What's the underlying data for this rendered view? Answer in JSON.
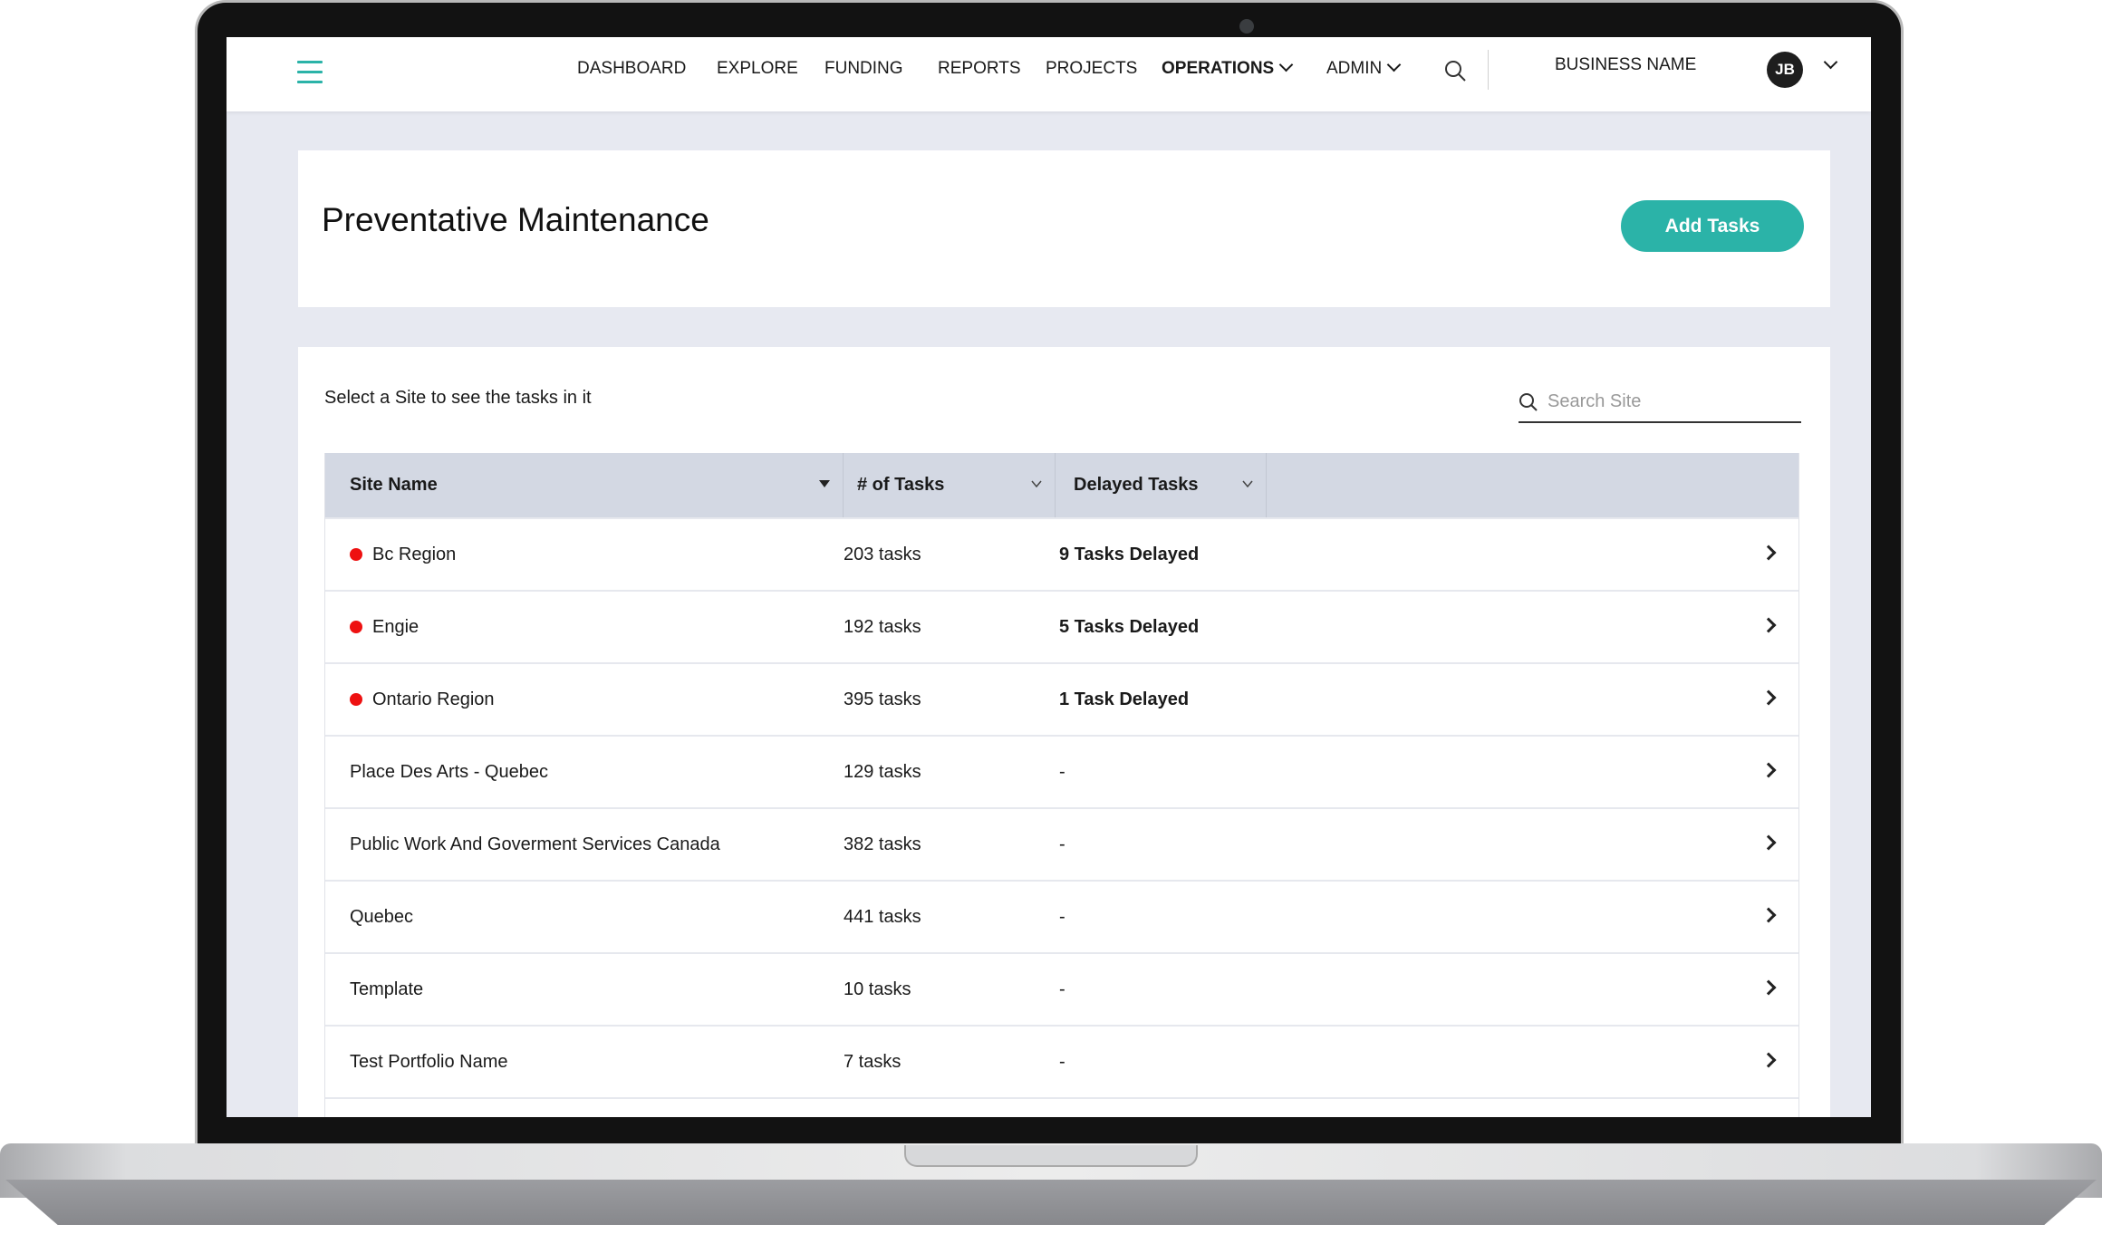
{
  "nav": {
    "items": [
      {
        "label": "DASHBOARD"
      },
      {
        "label": "EXPLORE"
      },
      {
        "label": "FUNDING"
      },
      {
        "label": "REPORTS"
      },
      {
        "label": "PROJECTS"
      },
      {
        "label": "OPERATIONS",
        "active": true,
        "dropdown": true
      },
      {
        "label": "ADMIN",
        "dropdown": true
      }
    ],
    "business_name": "BUSINESS NAME",
    "avatar_initials": "JB",
    "icons": {
      "menu": "hamburger-icon",
      "search": "search-icon",
      "user_menu": "chevron-down-icon"
    }
  },
  "header": {
    "title": "Preventative Maintenance",
    "add_button": "Add Tasks"
  },
  "sites": {
    "hint": "Select a Site to see the tasks in it",
    "search_placeholder": "Search Site",
    "search_value": "",
    "columns": [
      "Site Name",
      "# of Tasks",
      "Delayed Tasks"
    ],
    "rows": [
      {
        "name": "Bc Region",
        "tasks": "203 tasks",
        "delayed": "9 Tasks Delayed",
        "alert": true
      },
      {
        "name": "Engie",
        "tasks": "192 tasks",
        "delayed": "5 Tasks Delayed",
        "alert": true
      },
      {
        "name": "Ontario Region",
        "tasks": "395 tasks",
        "delayed": "1 Task Delayed",
        "alert": true
      },
      {
        "name": "Place Des Arts - Quebec",
        "tasks": "129 tasks",
        "delayed": "-",
        "alert": false
      },
      {
        "name": "Public Work And Goverment Services Canada",
        "tasks": "382 tasks",
        "delayed": "-",
        "alert": false
      },
      {
        "name": "Quebec",
        "tasks": "441 tasks",
        "delayed": "-",
        "alert": false
      },
      {
        "name": "Template",
        "tasks": "10 tasks",
        "delayed": "-",
        "alert": false
      },
      {
        "name": "Test Portfolio Name",
        "tasks": "7 tasks",
        "delayed": "-",
        "alert": false
      }
    ]
  },
  "colors": {
    "accent": "#2bb3a8",
    "alert": "#ee1111",
    "table_header": "#d3d8e3",
    "background": "#e7e9f1"
  }
}
